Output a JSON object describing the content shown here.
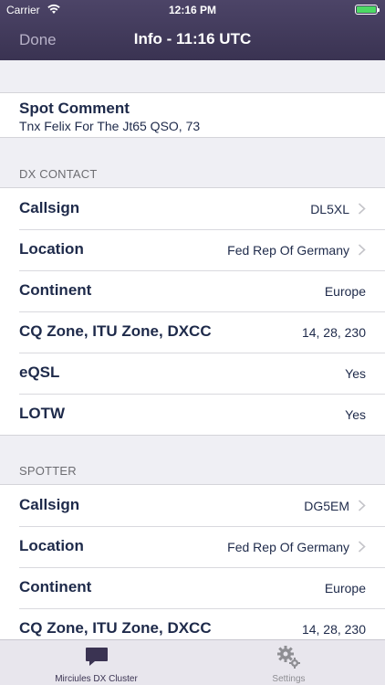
{
  "status_bar": {
    "carrier": "Carrier",
    "time": "12:16 PM",
    "battery_level": 1.0
  },
  "nav": {
    "done_label": "Done",
    "title": "Info - 11:16 UTC"
  },
  "spot_comment": {
    "title": "Spot Comment",
    "text": "Tnx Felix For The Jt65 QSO, 73"
  },
  "dx_contact": {
    "header": "DX CONTACT",
    "rows": [
      {
        "label": "Callsign",
        "value": "DL5XL"
      },
      {
        "label": "Location",
        "value": "Fed Rep Of Germany"
      },
      {
        "label": "Continent",
        "value": "Europe"
      },
      {
        "label": "CQ Zone, ITU Zone, DXCC",
        "value": "14, 28, 230"
      },
      {
        "label": "eQSL",
        "value": "Yes"
      },
      {
        "label": "LOTW",
        "value": "Yes"
      }
    ]
  },
  "spotter": {
    "header": "SPOTTER",
    "rows": [
      {
        "label": "Callsign",
        "value": "DG5EM"
      },
      {
        "label": "Location",
        "value": "Fed Rep Of Germany"
      },
      {
        "label": "Continent",
        "value": "Europe"
      },
      {
        "label": "CQ Zone, ITU Zone, DXCC",
        "value": "14, 28, 230"
      }
    ]
  },
  "tab_bar": {
    "tabs": [
      {
        "label": "Mirciules DX Cluster",
        "icon": "chat-bubble-icon",
        "active": true
      },
      {
        "label": "Settings",
        "icon": "gears-icon",
        "active": false
      }
    ]
  },
  "colors": {
    "nav_bg": "#3a3352",
    "accent": "#1e2a4a",
    "battery": "#4cd964"
  }
}
